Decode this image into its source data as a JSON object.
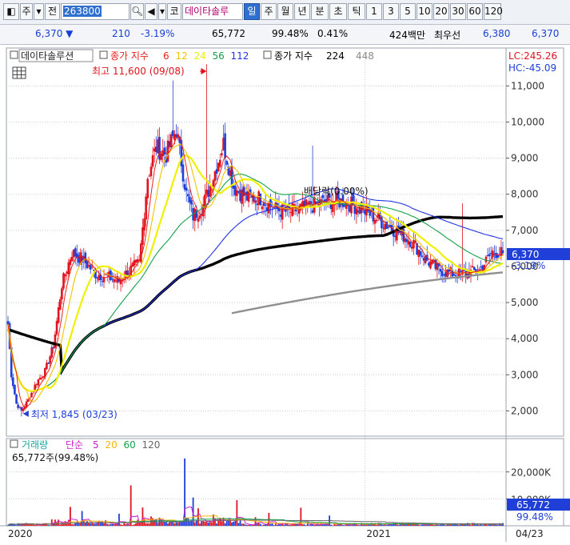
{
  "toolbar": {
    "buttons": [
      {
        "key": "layout",
        "label": "◧",
        "w": 20
      },
      {
        "key": "market",
        "label": "주",
        "w": 16
      },
      {
        "key": "market_dd",
        "label": "▾",
        "w": 13
      },
      {
        "key": "prev",
        "label": "전",
        "w": 19
      },
      {
        "key": "code",
        "label": "263800",
        "w": 86,
        "kind": "code"
      },
      {
        "key": "search",
        "label": "🔍︎",
        "w": 17
      },
      {
        "key": "sound",
        "label": "◀︎",
        "w": 16
      },
      {
        "key": "sound_dd",
        "label": "▾",
        "w": 10
      },
      {
        "key": "ko",
        "label": "코",
        "w": 18
      },
      {
        "key": "stock_name",
        "label": "데이타솔루",
        "w": 76,
        "kind": "name"
      },
      {
        "key": "day",
        "label": "일",
        "w": 20,
        "kind": "sel"
      },
      {
        "key": "week",
        "label": "주",
        "w": 20
      },
      {
        "key": "month",
        "label": "월",
        "w": 20
      },
      {
        "key": "year",
        "label": "년",
        "w": 20
      },
      {
        "key": "minute",
        "label": "분",
        "w": 22
      },
      {
        "key": "second",
        "label": "초",
        "w": 22
      },
      {
        "key": "tick",
        "label": "틱",
        "w": 22
      },
      {
        "key": "n1",
        "label": "1",
        "w": 20
      },
      {
        "key": "n3",
        "label": "3",
        "w": 20
      },
      {
        "key": "n5",
        "label": "5",
        "w": 20
      },
      {
        "key": "n10",
        "label": "10",
        "w": 20
      },
      {
        "key": "n20",
        "label": "20",
        "w": 20
      },
      {
        "key": "n30",
        "label": "30",
        "w": 20
      },
      {
        "key": "n60",
        "label": "60",
        "w": 20
      },
      {
        "key": "n120",
        "label": "120",
        "w": 22
      }
    ]
  },
  "quote": {
    "price": "6,370 ▼",
    "change": "210",
    "change_pct": "-3.19%",
    "volume": "65,772",
    "vol_ratio": "99.48%",
    "turnover": "0.41%",
    "amount": "424백만",
    "best_label": "최우선",
    "ask": "6,380",
    "bid": "6,370"
  },
  "colors": {
    "up": "#e0141e",
    "down": "#1f3fd8",
    "ma6": "#e8231e",
    "ma12": "#f2c300",
    "ma24": "#f0f000",
    "ma56": "#16a04a",
    "ma112": "#2233e6",
    "ma224": "#000000",
    "ma448": "#8f8f8f",
    "vol5": "#cc22cc",
    "vol20": "#f2b700",
    "vol60": "#13a14a",
    "vol120": "#666666"
  },
  "chart_data": [
    {
      "type": "candlestick",
      "name": "price",
      "legend": {
        "stock": "데이타솔루션",
        "ma_prefix": "종가 지수",
        "ma_periods": [
          "6",
          "12",
          "24",
          "56",
          "112"
        ],
        "ma_prefix2": "종가 지수",
        "ma_periods2": [
          "224",
          "448"
        ]
      },
      "high_label": "최고 11,600 (09/08)",
      "low_label": "최저 1,845 (03/23)",
      "dividend_label": "배당락(0.00%)",
      "lc_label": "LC:245.26",
      "hc_label": "HC:-45.09",
      "last_price_label": "6,370",
      "last_change_label": "-3.19%",
      "y_ticks": [
        "11,000",
        "10,000",
        "9,000",
        "8,000",
        "7,000",
        "6,000",
        "5,000",
        "4,000",
        "3,000",
        "2,000"
      ],
      "y_tick_values": [
        11000,
        10000,
        9000,
        8000,
        7000,
        6000,
        5000,
        4000,
        3000,
        2000
      ],
      "ylim": [
        1300,
        12050
      ],
      "x_labels": [
        "2020",
        "2021",
        "04/23"
      ],
      "anchors": [
        [
          0,
          4400
        ],
        [
          2,
          3000
        ],
        [
          5,
          2200
        ],
        [
          8,
          2000
        ],
        [
          12,
          2300
        ],
        [
          17,
          2800
        ],
        [
          22,
          3100
        ],
        [
          27,
          3800
        ],
        [
          32,
          5500
        ],
        [
          38,
          6400
        ],
        [
          44,
          6200
        ],
        [
          52,
          5800
        ],
        [
          60,
          5700
        ],
        [
          66,
          5600
        ],
        [
          72,
          5900
        ],
        [
          78,
          6100
        ],
        [
          83,
          8500
        ],
        [
          88,
          9300
        ],
        [
          94,
          9100
        ],
        [
          100,
          9800
        ],
        [
          106,
          8000
        ],
        [
          110,
          7400
        ],
        [
          116,
          7700
        ],
        [
          122,
          8500
        ],
        [
          128,
          9400
        ],
        [
          134,
          8200
        ],
        [
          142,
          7900
        ],
        [
          150,
          7900
        ],
        [
          158,
          7600
        ],
        [
          166,
          7500
        ],
        [
          174,
          7600
        ],
        [
          182,
          7700
        ],
        [
          190,
          7800
        ],
        [
          200,
          7800
        ],
        [
          210,
          7600
        ],
        [
          220,
          7300
        ],
        [
          230,
          7000
        ],
        [
          240,
          6700
        ],
        [
          248,
          6200
        ],
        [
          256,
          5900
        ],
        [
          264,
          5800
        ],
        [
          272,
          5800
        ],
        [
          280,
          5900
        ],
        [
          288,
          6400
        ],
        [
          294,
          6370
        ]
      ]
    },
    {
      "type": "bar",
      "name": "volume",
      "legend": {
        "title": "거래량",
        "ma_prefix": "단순",
        "ma_periods": [
          "5",
          "20",
          "60",
          "120"
        ]
      },
      "info": "65,772주(99.48%)",
      "y_ticks": [
        "20,000K",
        "10,000K"
      ],
      "last_label": "65,772",
      "last_pct": "99.48%"
    }
  ]
}
